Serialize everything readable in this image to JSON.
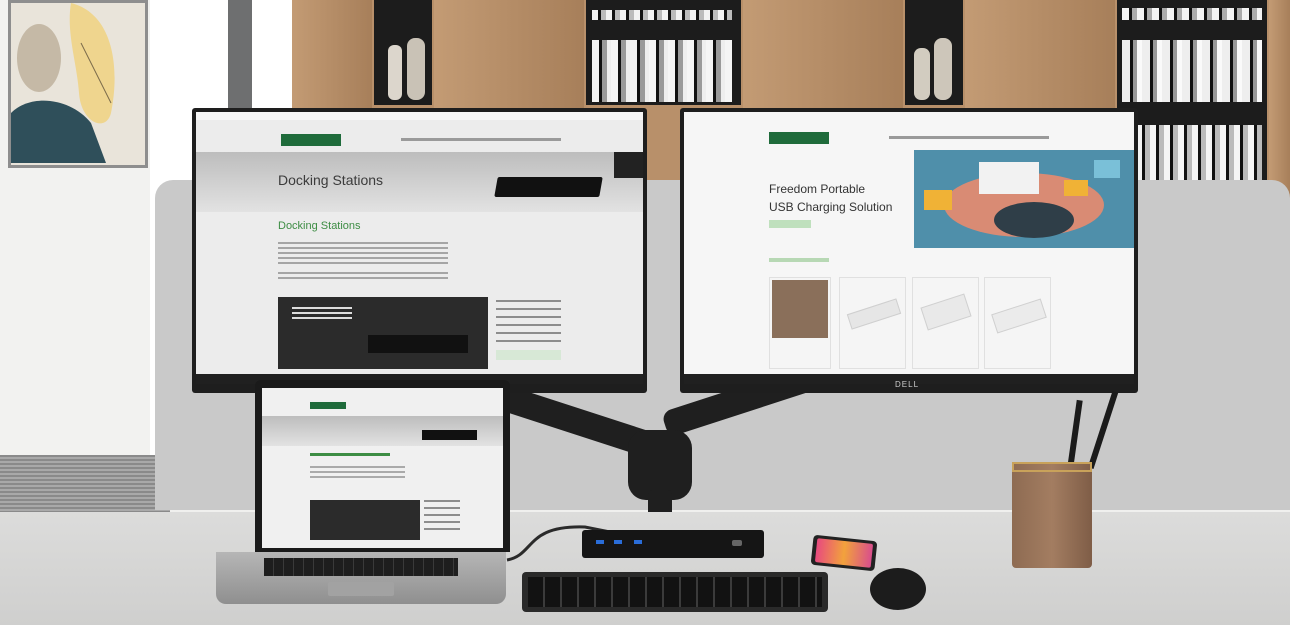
{
  "scene": "Dual monitor desk setup with laptop and docking station",
  "left_monitor": {
    "hero_text": "Docking Stations",
    "section_title": "Docking Stations"
  },
  "right_monitor": {
    "hero_text_line1": "Freedom Portable",
    "hero_text_line2": "USB Charging Solution",
    "brand": "DELL"
  },
  "colors": {
    "wood": "#b8906a",
    "panel": "#c9c9c9",
    "accent_green": "#3d8d44"
  }
}
